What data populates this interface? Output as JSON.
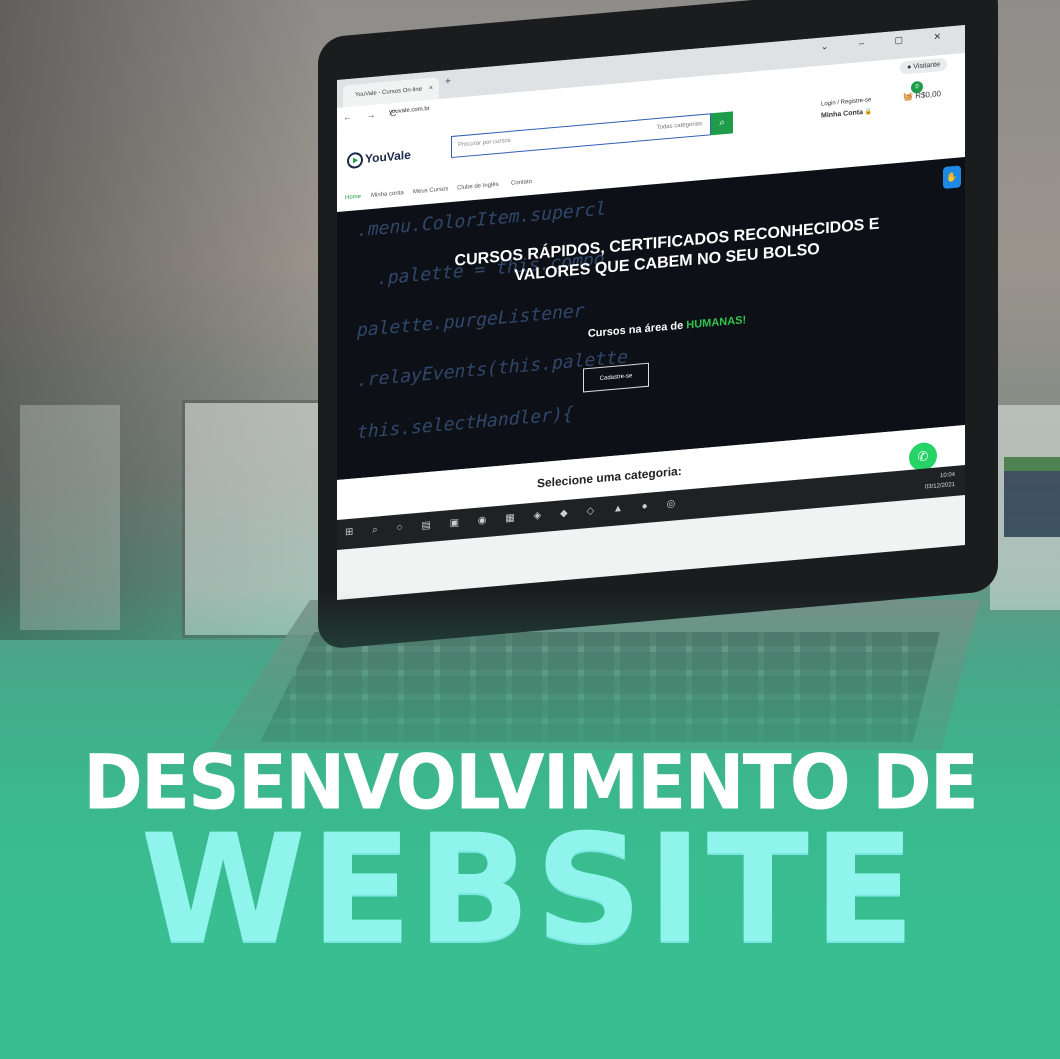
{
  "browser": {
    "tab_title": "YouVale - Cursos On-line",
    "tab_close": "×",
    "new_tab": "+",
    "window_controls": "⌄ – ▢ ✕",
    "nav_icons": "← → C",
    "url": "youvale.com.br",
    "profile_label": "Visitante"
  },
  "site": {
    "logo_text": "YouVale",
    "search_placeholder": "Procurar por cursos",
    "search_category": "Todas categorias",
    "search_icon": "search-icon",
    "login_text": "Login / Registre-se",
    "account_text": "Minha Conta",
    "cart_count": "0",
    "cart_total": "R$0,00",
    "menu": [
      "Home",
      "Minha conta",
      "Meus Cursos",
      "Clube de Inglês",
      "Contato"
    ],
    "hero_title": "CURSOS RÁPIDOS, CERTIFICADOS RECONHECIDOS E VALORES QUE CABEM NO SEU BOLSO",
    "hero_sub_prefix": "Cursos na área de",
    "hero_sub_highlight": "HUMANAS!",
    "cta_label": "Cadastre-se",
    "categories_title": "Selecione uma categoria:"
  },
  "taskbar": {
    "time": "10:04",
    "date": "03/12/2021"
  },
  "headline": {
    "line1": "DESENVOLVIMENTO DE",
    "line2": "WEBSITE"
  },
  "colors": {
    "accent_green": "#1f9c4a",
    "headline_cyan": "#8ff4ec",
    "bg_green": "#3bbf92"
  }
}
